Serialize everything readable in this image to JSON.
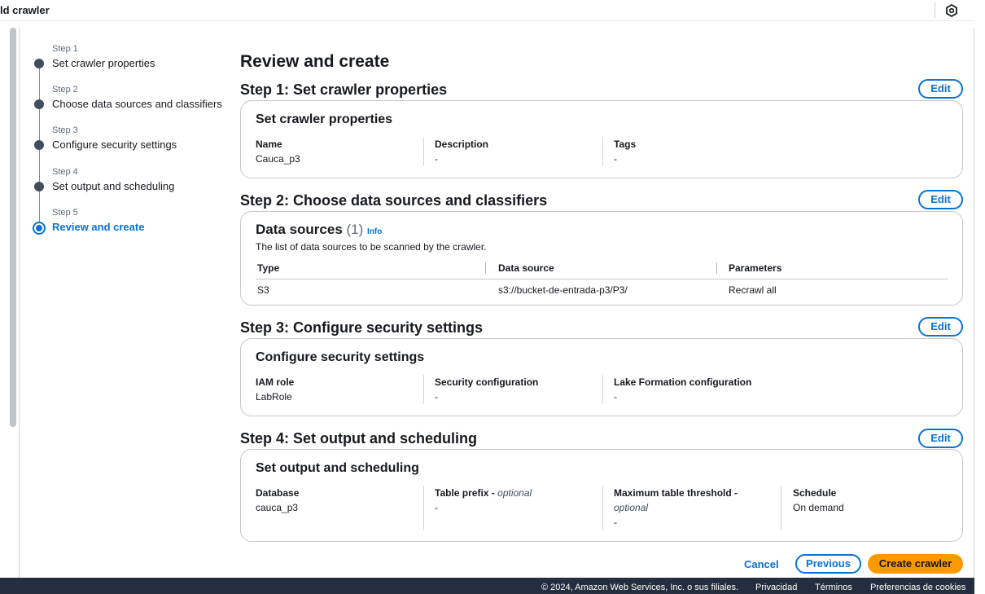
{
  "window": {
    "title": "ld crawler"
  },
  "steps": [
    {
      "num": "Step 1",
      "label": "Set crawler properties"
    },
    {
      "num": "Step 2",
      "label": "Choose data sources and classifiers"
    },
    {
      "num": "Step 3",
      "label": "Configure security settings"
    },
    {
      "num": "Step 4",
      "label": "Set output and scheduling"
    },
    {
      "num": "Step 5",
      "label": "Review and create"
    }
  ],
  "active_step": 5,
  "page_title": "Review and create",
  "edit_label": "Edit",
  "section1": {
    "heading": "Step 1: Set crawler properties",
    "card_title": "Set crawler properties",
    "fields": [
      {
        "key": "Name",
        "value": "Cauca_p3"
      },
      {
        "key": "Description",
        "value": "-"
      },
      {
        "key": "Tags",
        "value": "-"
      }
    ]
  },
  "section2": {
    "heading": "Step 2: Choose data sources and classifiers",
    "title": "Data sources",
    "count": "(1)",
    "info": "Info",
    "description": "The list of data sources to be scanned by the crawler.",
    "columns": [
      "Type",
      "Data source",
      "Parameters"
    ],
    "rows": [
      [
        "S3",
        "s3://bucket-de-entrada-p3/P3/",
        "Recrawl all"
      ]
    ]
  },
  "section3": {
    "heading": "Step 3: Configure security settings",
    "card_title": "Configure security settings",
    "fields": [
      {
        "key": "IAM role",
        "value": "LabRole"
      },
      {
        "key": "Security configuration",
        "value": "-"
      },
      {
        "key": "Lake Formation configuration",
        "value": "-"
      }
    ]
  },
  "section4": {
    "heading": "Step 4: Set output and scheduling",
    "card_title": "Set output and scheduling",
    "fields": [
      {
        "key": "Database",
        "value": "cauca_p3"
      },
      {
        "key": "Table prefix - ",
        "optional": "optional",
        "value": "-"
      },
      {
        "key": "Maximum table threshold - ",
        "optional": "optional",
        "value": "-"
      },
      {
        "key": "Schedule",
        "value": "On demand"
      }
    ]
  },
  "actions": {
    "cancel": "Cancel",
    "previous": "Previous",
    "create": "Create crawler"
  },
  "footer": {
    "copyright": "© 2024, Amazon Web Services, Inc. o sus filiales.",
    "privacy": "Privacidad",
    "terms": "Términos",
    "cookies": "Preferencias de cookies"
  },
  "colors": {
    "accent": "#0972d3",
    "primary_button": "#ff9900",
    "footer_bg": "#232f3e"
  }
}
